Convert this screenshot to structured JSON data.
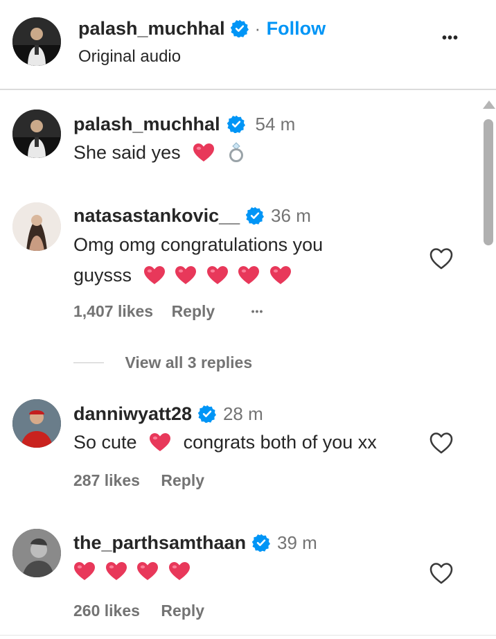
{
  "header": {
    "username": "palash_muchhal",
    "separator": "·",
    "follow_label": "Follow",
    "subtitle": "Original audio",
    "more_label": "•••"
  },
  "caption": {
    "username": "palash_muchhal",
    "time": "54 m",
    "text": "She said yes"
  },
  "comments": [
    {
      "username": "natasastankovic__",
      "time": "36 m",
      "text_line1": "Omg omg congratulations you",
      "text_line2": "guysss",
      "hearts": 5,
      "likes": "1,407 likes",
      "reply_label": "Reply",
      "more_label": "•••",
      "view_replies": "View all 3 replies"
    },
    {
      "username": "danniwyatt28",
      "time": "28 m",
      "text_before": "So cute",
      "text_after": "congrats both of you xx",
      "likes": "287 likes",
      "reply_label": "Reply"
    },
    {
      "username": "the_parthsamthaan",
      "time": "39 m",
      "hearts": 4,
      "likes": "260 likes",
      "reply_label": "Reply"
    }
  ],
  "colors": {
    "heart_emoji": "#e8385a",
    "verified": "#0095f6",
    "follow": "#0095f6",
    "secondary_text": "#737373"
  }
}
